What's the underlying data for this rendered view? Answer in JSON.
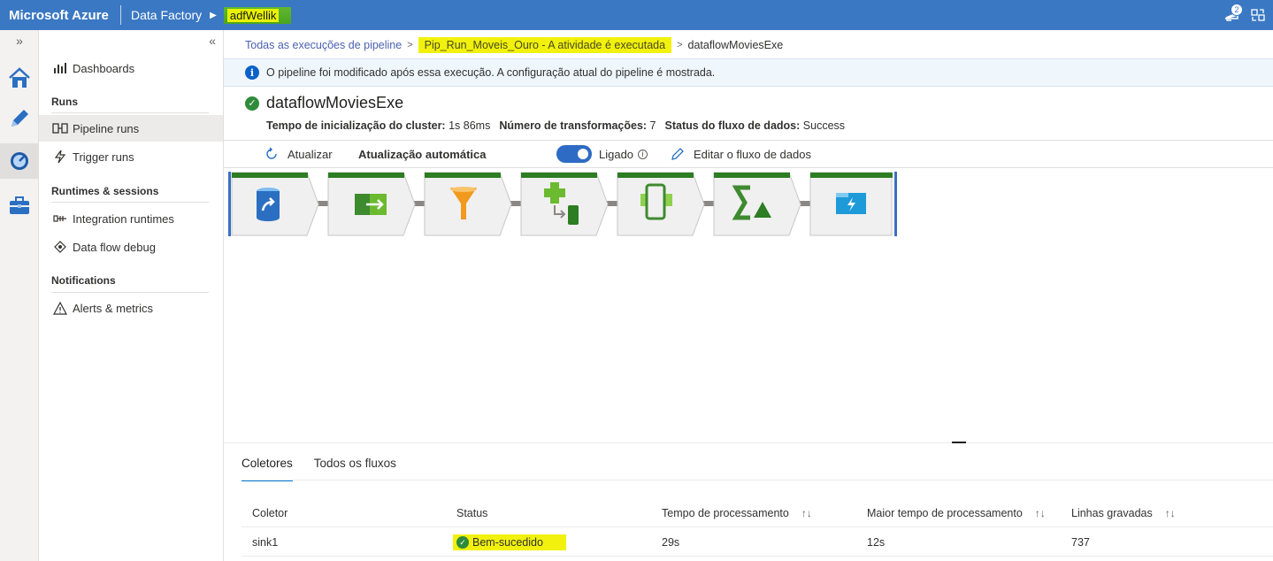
{
  "topbar": {
    "brand": "Microsoft Azure",
    "product": "Data Factory",
    "factory_name": "adfWellik",
    "notification_count": "2"
  },
  "nav": {
    "items": [
      {
        "label": "Dashboards"
      },
      {
        "label": "Pipeline runs"
      },
      {
        "label": "Trigger runs"
      },
      {
        "label": "Integration runtimes"
      },
      {
        "label": "Data flow debug"
      },
      {
        "label": "Alerts & metrics"
      }
    ],
    "sections": {
      "runs": "Runs",
      "runtimes": "Runtimes & sessions",
      "notifications": "Notifications"
    }
  },
  "breadcrumb": {
    "root": "Todas as execuções de pipeline",
    "pipeline": "Pip_Run_Moveis_Ouro - A atividade é executada",
    "current": "dataflowMoviesExe"
  },
  "info": {
    "message": "O pipeline foi modificado após essa execução. A configuração atual do pipeline é mostrada."
  },
  "run": {
    "title": "dataflowMoviesExe",
    "cluster_label": "Tempo de inicialização do cluster:",
    "cluster_value": "1s 86ms",
    "transforms_label": "Número de transformações:",
    "transforms_value": "7",
    "status_label": "Status do fluxo de dados:",
    "status_value": "Success"
  },
  "toolbar": {
    "refresh": "Atualizar",
    "auto_refresh": "Atualização automática",
    "toggle_state": "Ligado",
    "edit": "Editar o fluxo de dados"
  },
  "tabs": [
    {
      "label": "Coletores"
    },
    {
      "label": "Todos os fluxos"
    }
  ],
  "table": {
    "headers": [
      "Coletor",
      "Status",
      "Tempo de processamento",
      "Maior tempo de processamento",
      "Linhas gravadas"
    ],
    "rows": [
      {
        "coletor": "sink1",
        "status": "Bem-sucedido",
        "tempo": "29s",
        "maior": "12s",
        "linhas": "737"
      }
    ]
  },
  "colors": {
    "topbar": "#3a78c3",
    "highlight": "#f1f10d",
    "success": "#2e8b3a",
    "accent": "#0078d4"
  }
}
